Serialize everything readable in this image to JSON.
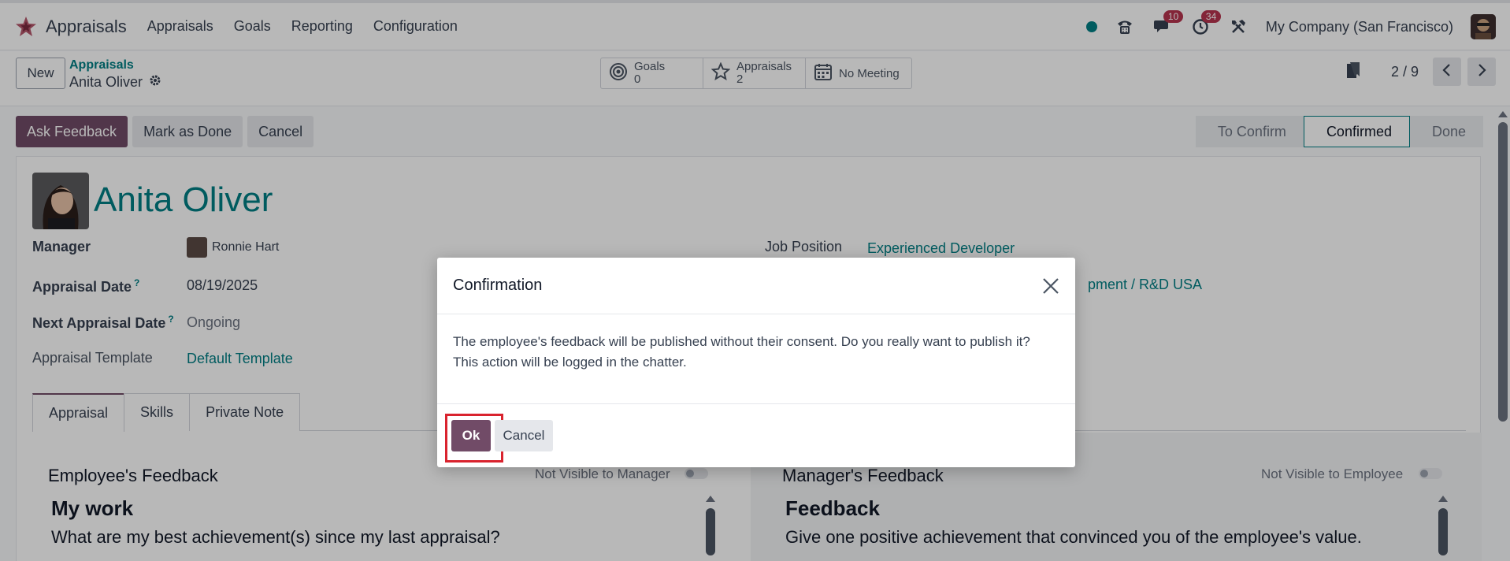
{
  "navbar": {
    "app_name": "Appraisals",
    "menu": [
      "Appraisals",
      "Goals",
      "Reporting",
      "Configuration"
    ],
    "messages_badge": "10",
    "activities_badge": "34",
    "company": "My Company (San Francisco)"
  },
  "control_panel": {
    "new_label": "New",
    "breadcrumb_parent": "Appraisals",
    "breadcrumb_current": "Anita Oliver",
    "smart_buttons": {
      "goals_label": "Goals",
      "goals_count": "0",
      "appraisals_label": "Appraisals",
      "appraisals_count": "2",
      "meeting_label": "No Meeting"
    },
    "pager": "2 / 9"
  },
  "statusbar": {
    "ask_feedback": "Ask Feedback",
    "mark_done": "Mark as Done",
    "cancel": "Cancel",
    "stages": [
      "To Confirm",
      "Confirmed",
      "Done"
    ],
    "active_stage": "Confirmed"
  },
  "form": {
    "employee_name": "Anita Oliver",
    "manager_label": "Manager",
    "manager_value": "Ronnie Hart",
    "appraisal_date_label": "Appraisal Date",
    "appraisal_date_value": "08/19/2025",
    "next_appraisal_label": "Next Appraisal Date",
    "next_appraisal_value": "Ongoing",
    "template_label": "Appraisal Template",
    "template_value": "Default Template",
    "job_position_label": "Job Position",
    "job_position_value": "Experienced Developer",
    "department_partial": "pment / R&D USA",
    "help_mark": "?",
    "tabs": [
      "Appraisal",
      "Skills",
      "Private Note"
    ],
    "employee_feedback": {
      "title": "Employee's Feedback",
      "visibility": "Not Visible to Manager",
      "heading": "My work",
      "question": "What are my best achievement(s) since my last appraisal?"
    },
    "manager_feedback": {
      "title": "Manager's Feedback",
      "visibility": "Not Visible to Employee",
      "heading": "Feedback",
      "question": "Give one positive achievement that convinced you of the employee's value."
    }
  },
  "dialog": {
    "title": "Confirmation",
    "body_line1": "The employee's feedback will be published without their consent. Do you really want to publish it?",
    "body_line2": "This action will be logged in the chatter.",
    "ok_label": "Ok",
    "cancel_label": "Cancel"
  },
  "colors": {
    "brand": "#714b67",
    "link": "#017e84",
    "highlight": "#d9232e"
  }
}
